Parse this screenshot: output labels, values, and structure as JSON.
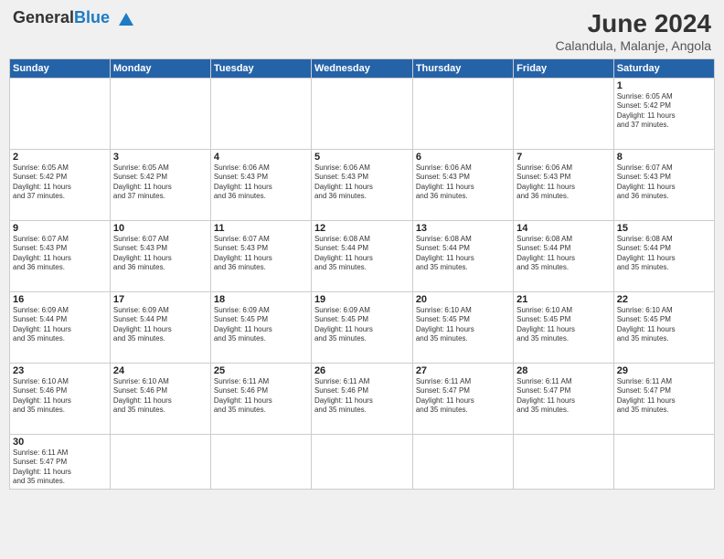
{
  "header": {
    "logo_general": "General",
    "logo_blue": "Blue",
    "month_year": "June 2024",
    "location": "Calandula, Malanje, Angola"
  },
  "days_of_week": [
    "Sunday",
    "Monday",
    "Tuesday",
    "Wednesday",
    "Thursday",
    "Friday",
    "Saturday"
  ],
  "weeks": [
    [
      {
        "day": "",
        "info": ""
      },
      {
        "day": "",
        "info": ""
      },
      {
        "day": "",
        "info": ""
      },
      {
        "day": "",
        "info": ""
      },
      {
        "day": "",
        "info": ""
      },
      {
        "day": "",
        "info": ""
      },
      {
        "day": "1",
        "info": "Sunrise: 6:05 AM\nSunset: 5:42 PM\nDaylight: 11 hours\nand 37 minutes."
      }
    ],
    [
      {
        "day": "2",
        "info": "Sunrise: 6:05 AM\nSunset: 5:42 PM\nDaylight: 11 hours\nand 37 minutes."
      },
      {
        "day": "3",
        "info": "Sunrise: 6:05 AM\nSunset: 5:42 PM\nDaylight: 11 hours\nand 37 minutes."
      },
      {
        "day": "4",
        "info": "Sunrise: 6:06 AM\nSunset: 5:43 PM\nDaylight: 11 hours\nand 36 minutes."
      },
      {
        "day": "5",
        "info": "Sunrise: 6:06 AM\nSunset: 5:43 PM\nDaylight: 11 hours\nand 36 minutes."
      },
      {
        "day": "6",
        "info": "Sunrise: 6:06 AM\nSunset: 5:43 PM\nDaylight: 11 hours\nand 36 minutes."
      },
      {
        "day": "7",
        "info": "Sunrise: 6:06 AM\nSunset: 5:43 PM\nDaylight: 11 hours\nand 36 minutes."
      },
      {
        "day": "8",
        "info": "Sunrise: 6:07 AM\nSunset: 5:43 PM\nDaylight: 11 hours\nand 36 minutes."
      }
    ],
    [
      {
        "day": "9",
        "info": "Sunrise: 6:07 AM\nSunset: 5:43 PM\nDaylight: 11 hours\nand 36 minutes."
      },
      {
        "day": "10",
        "info": "Sunrise: 6:07 AM\nSunset: 5:43 PM\nDaylight: 11 hours\nand 36 minutes."
      },
      {
        "day": "11",
        "info": "Sunrise: 6:07 AM\nSunset: 5:43 PM\nDaylight: 11 hours\nand 36 minutes."
      },
      {
        "day": "12",
        "info": "Sunrise: 6:08 AM\nSunset: 5:44 PM\nDaylight: 11 hours\nand 35 minutes."
      },
      {
        "day": "13",
        "info": "Sunrise: 6:08 AM\nSunset: 5:44 PM\nDaylight: 11 hours\nand 35 minutes."
      },
      {
        "day": "14",
        "info": "Sunrise: 6:08 AM\nSunset: 5:44 PM\nDaylight: 11 hours\nand 35 minutes."
      },
      {
        "day": "15",
        "info": "Sunrise: 6:08 AM\nSunset: 5:44 PM\nDaylight: 11 hours\nand 35 minutes."
      }
    ],
    [
      {
        "day": "16",
        "info": "Sunrise: 6:09 AM\nSunset: 5:44 PM\nDaylight: 11 hours\nand 35 minutes."
      },
      {
        "day": "17",
        "info": "Sunrise: 6:09 AM\nSunset: 5:44 PM\nDaylight: 11 hours\nand 35 minutes."
      },
      {
        "day": "18",
        "info": "Sunrise: 6:09 AM\nSunset: 5:45 PM\nDaylight: 11 hours\nand 35 minutes."
      },
      {
        "day": "19",
        "info": "Sunrise: 6:09 AM\nSunset: 5:45 PM\nDaylight: 11 hours\nand 35 minutes."
      },
      {
        "day": "20",
        "info": "Sunrise: 6:10 AM\nSunset: 5:45 PM\nDaylight: 11 hours\nand 35 minutes."
      },
      {
        "day": "21",
        "info": "Sunrise: 6:10 AM\nSunset: 5:45 PM\nDaylight: 11 hours\nand 35 minutes."
      },
      {
        "day": "22",
        "info": "Sunrise: 6:10 AM\nSunset: 5:45 PM\nDaylight: 11 hours\nand 35 minutes."
      }
    ],
    [
      {
        "day": "23",
        "info": "Sunrise: 6:10 AM\nSunset: 5:46 PM\nDaylight: 11 hours\nand 35 minutes."
      },
      {
        "day": "24",
        "info": "Sunrise: 6:10 AM\nSunset: 5:46 PM\nDaylight: 11 hours\nand 35 minutes."
      },
      {
        "day": "25",
        "info": "Sunrise: 6:11 AM\nSunset: 5:46 PM\nDaylight: 11 hours\nand 35 minutes."
      },
      {
        "day": "26",
        "info": "Sunrise: 6:11 AM\nSunset: 5:46 PM\nDaylight: 11 hours\nand 35 minutes."
      },
      {
        "day": "27",
        "info": "Sunrise: 6:11 AM\nSunset: 5:47 PM\nDaylight: 11 hours\nand 35 minutes."
      },
      {
        "day": "28",
        "info": "Sunrise: 6:11 AM\nSunset: 5:47 PM\nDaylight: 11 hours\nand 35 minutes."
      },
      {
        "day": "29",
        "info": "Sunrise: 6:11 AM\nSunset: 5:47 PM\nDaylight: 11 hours\nand 35 minutes."
      }
    ],
    [
      {
        "day": "30",
        "info": "Sunrise: 6:11 AM\nSunset: 5:47 PM\nDaylight: 11 hours\nand 35 minutes."
      },
      {
        "day": "",
        "info": ""
      },
      {
        "day": "",
        "info": ""
      },
      {
        "day": "",
        "info": ""
      },
      {
        "day": "",
        "info": ""
      },
      {
        "day": "",
        "info": ""
      },
      {
        "day": "",
        "info": ""
      }
    ]
  ]
}
